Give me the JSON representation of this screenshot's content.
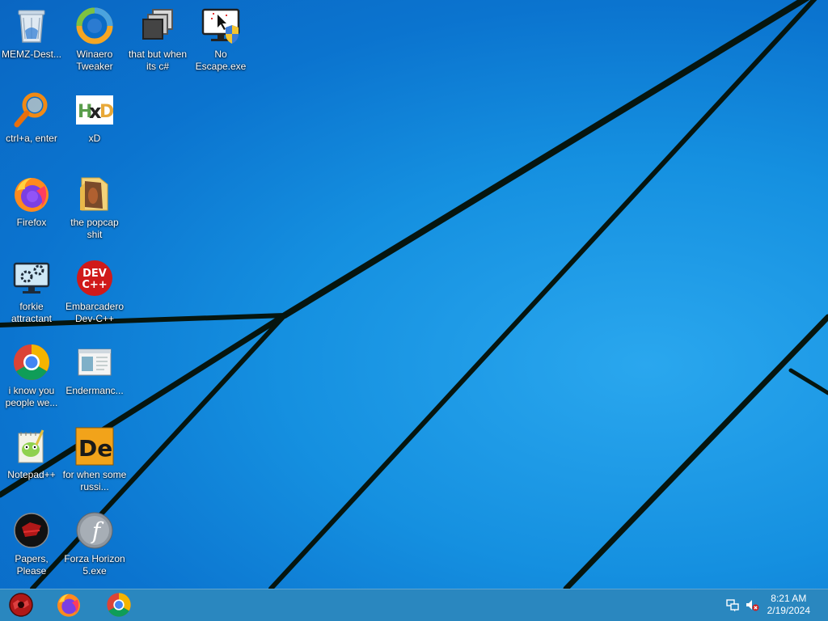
{
  "desktop": {
    "icons": [
      {
        "label": "MEMZ-Dest...",
        "icon": "recycle-bin-icon"
      },
      {
        "label": "Winaero Tweaker",
        "icon": "winaero-tweaker-icon"
      },
      {
        "label": "that but when its c#",
        "icon": "stacked-windows-icon"
      },
      {
        "label": "No Escape.exe",
        "icon": "monitor-shield-icon"
      },
      {
        "label": "ctrl+a, enter",
        "icon": "magnifier-icon"
      },
      {
        "label": "xD",
        "icon": "hxd-icon"
      },
      {
        "label": "Firefox",
        "icon": "firefox-icon"
      },
      {
        "label": "the popcap shit",
        "icon": "folder-icon"
      },
      {
        "label": "forkie attractant",
        "icon": "monitor-gears-icon"
      },
      {
        "label": "Embarcadero Dev-C++",
        "icon": "devcpp-icon"
      },
      {
        "label": "i know you people we...",
        "icon": "chrome-icon"
      },
      {
        "label": "Endermanc...",
        "icon": "window-app-icon"
      },
      {
        "label": "Notepad++",
        "icon": "notepadpp-icon"
      },
      {
        "label": "for when some russi...",
        "icon": "de-icon"
      },
      {
        "label": "Papers, Please",
        "icon": "papers-please-icon"
      },
      {
        "label": "Forza Horizon 5.exe",
        "icon": "flash-icon"
      }
    ]
  },
  "taskbar": {
    "pinned": [
      {
        "icon": "start-orb-icon"
      },
      {
        "icon": "firefox-icon"
      },
      {
        "icon": "chrome-icon"
      }
    ],
    "tray": {
      "network_icon": "network-icon",
      "volume_icon": "volume-muted-icon"
    },
    "clock": {
      "time": "8:21 AM",
      "date": "2/19/2024"
    }
  },
  "colors": {
    "wallpaper_blue": "#1590e0",
    "taskbar": "#2a87bf"
  }
}
